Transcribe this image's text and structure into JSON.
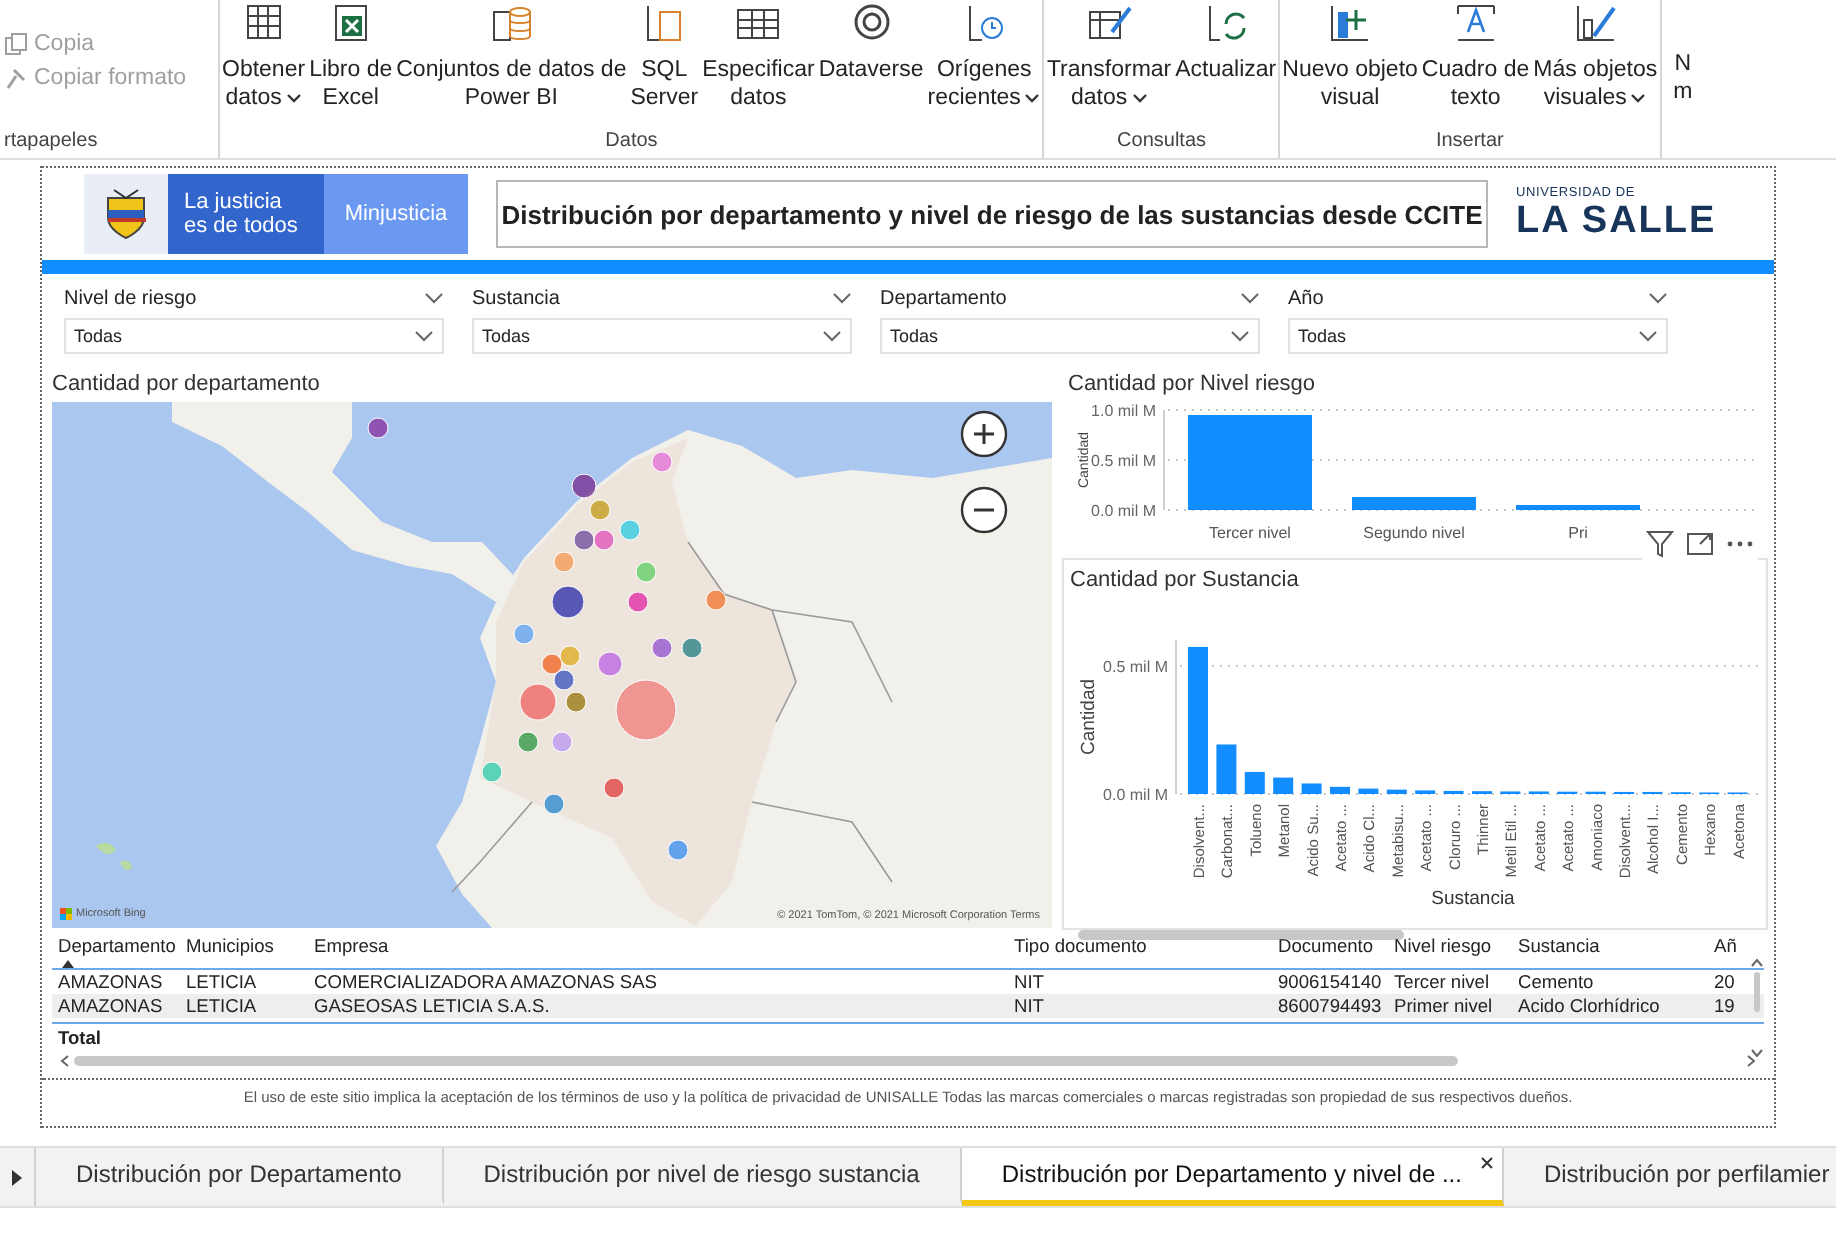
{
  "ribbon": {
    "clipboard": {
      "items": [
        {
          "label": "Copia",
          "disabled": true
        },
        {
          "label": "Copiar formato",
          "disabled": true
        }
      ],
      "group_label": "rtapapeles"
    },
    "groups": [
      {
        "label": "Datos",
        "buttons": [
          {
            "lines": [
              "Obtener",
              "datos"
            ],
            "dropdown": true
          },
          {
            "lines": [
              "Libro de",
              "Excel"
            ],
            "dropdown": false
          },
          {
            "lines": [
              "Conjuntos de datos de",
              "Power BI"
            ],
            "dropdown": false
          },
          {
            "lines": [
              "SQL",
              "Server"
            ],
            "dropdown": false
          },
          {
            "lines": [
              "Especificar",
              "datos"
            ],
            "dropdown": false
          },
          {
            "lines": [
              "Dataverse"
            ],
            "dropdown": false
          },
          {
            "lines": [
              "Orígenes",
              "recientes"
            ],
            "dropdown": true
          }
        ]
      },
      {
        "label": "Consultas",
        "buttons": [
          {
            "lines": [
              "Transformar",
              "datos"
            ],
            "dropdown": true
          },
          {
            "lines": [
              "Actualizar"
            ],
            "dropdown": false
          }
        ]
      },
      {
        "label": "Insertar",
        "buttons": [
          {
            "lines": [
              "Nuevo objeto",
              "visual"
            ],
            "dropdown": false
          },
          {
            "lines": [
              "Cuadro de",
              "texto"
            ],
            "dropdown": false
          },
          {
            "lines": [
              "Más objetos",
              "visuales"
            ],
            "dropdown": true
          }
        ]
      }
    ],
    "cut_button": {
      "lines": [
        "N",
        "m"
      ]
    }
  },
  "header": {
    "slogan": [
      "La justicia",
      "es de todos"
    ],
    "ministry": "Minjusticia",
    "title": "Distribución por departamento y nivel de riesgo de las sustancias desde CCITE",
    "logo_small": "UNIVERSIDAD DE",
    "logo": "LA SALLE"
  },
  "slicers": [
    {
      "label": "Nivel de riesgo",
      "value": "Todas"
    },
    {
      "label": "Sustancia",
      "value": "Todas"
    },
    {
      "label": "Departamento",
      "value": "Todas"
    },
    {
      "label": "Año",
      "value": "Todas"
    }
  ],
  "map": {
    "title": "Cantidad por departamento",
    "attribution": "Microsoft Bing",
    "copyright": "© 2021 TomTom, © 2021 Microsoft Corporation  Terms"
  },
  "risk_chart": {
    "title": "Cantidad por Nivel riesgo",
    "chart_data": {
      "type": "bar",
      "ylabel": "Cantidad",
      "categories": [
        "Tercer nivel",
        "Segundo nivel",
        "Pri"
      ],
      "series": [
        {
          "color": "#118dff",
          "values": [
            0.95,
            0.13,
            0.05
          ]
        }
      ],
      "ylim": [
        0,
        1.0
      ],
      "yticks": [
        {
          "value": 0,
          "label": "0.0 mil M"
        },
        {
          "value": 0.5,
          "label": "0.5 mil M"
        },
        {
          "value": 1.0,
          "label": "1.0 mil M"
        }
      ]
    }
  },
  "substance_chart": {
    "title": "Cantidad por Sustancia",
    "chart_data": {
      "type": "bar",
      "xlabel": "Sustancia",
      "ylabel": "Cantidad",
      "categories": [
        "Disolvent...",
        "Carbonat...",
        "Tolueno",
        "Metanol",
        "Acido Su...",
        "Acetato ...",
        "Acido Cl...",
        "Metabisu...",
        "Acetato ...",
        "Cloruro ...",
        "Thinner",
        "Metil Etil ...",
        "Acetato ...",
        "Acetato ...",
        "Amoniaco",
        "Disolvent...",
        "Alcohol I...",
        "Cemento",
        "Hexano",
        "Acetona"
      ],
      "series": [
        {
          "color": "#118dff",
          "values": [
            0.573,
            0.193,
            0.086,
            0.064,
            0.041,
            0.028,
            0.021,
            0.017,
            0.014,
            0.012,
            0.011,
            0.01,
            0.01,
            0.009,
            0.009,
            0.008,
            0.008,
            0.007,
            0.006,
            0.006
          ]
        }
      ],
      "ylim": [
        0,
        0.6
      ],
      "yticks": [
        {
          "value": 0,
          "label": "0.0 mil M"
        },
        {
          "value": 0.5,
          "label": "0.5 mil M"
        }
      ]
    }
  },
  "table": {
    "columns": [
      {
        "label": "Departamento",
        "sorted": true
      },
      {
        "label": "Municipios",
        "sorted": false
      },
      {
        "label": "Empresa",
        "sorted": false
      },
      {
        "label": "Tipo documento",
        "sorted": false
      },
      {
        "label": "Documento",
        "sorted": false
      },
      {
        "label": "Nivel riesgo",
        "sorted": false
      },
      {
        "label": "Sustancia",
        "sorted": false
      },
      {
        "label": "Añ",
        "sorted": false
      }
    ],
    "rows": [
      [
        "AMAZONAS",
        "LETICIA",
        "COMERCIALIZADORA AMAZONAS SAS",
        "NIT",
        "9006154140",
        "Tercer nivel",
        "Cemento",
        "20"
      ],
      [
        "AMAZONAS",
        "LETICIA",
        "GASEOSAS LETICIA S.A.S.",
        "NIT",
        "8600794493",
        "Primer nivel",
        "Acido Clorhídrico",
        "19"
      ]
    ],
    "total_label": "Total"
  },
  "footer": "El uso de este sitio implica la aceptación de los términos de uso y la política de privacidad de UNISALLE Todas las marcas comerciales o marcas registradas son propiedad de sus respectivos dueños.",
  "page_tabs": [
    {
      "label": "Distribución por Departamento",
      "selected": false
    },
    {
      "label": "Distribución por nivel de riesgo sustancia",
      "selected": false
    },
    {
      "label": "Distribución por Departamento y nivel de ...",
      "selected": true
    },
    {
      "label": "Distribución por perfilamier",
      "selected": false
    }
  ]
}
